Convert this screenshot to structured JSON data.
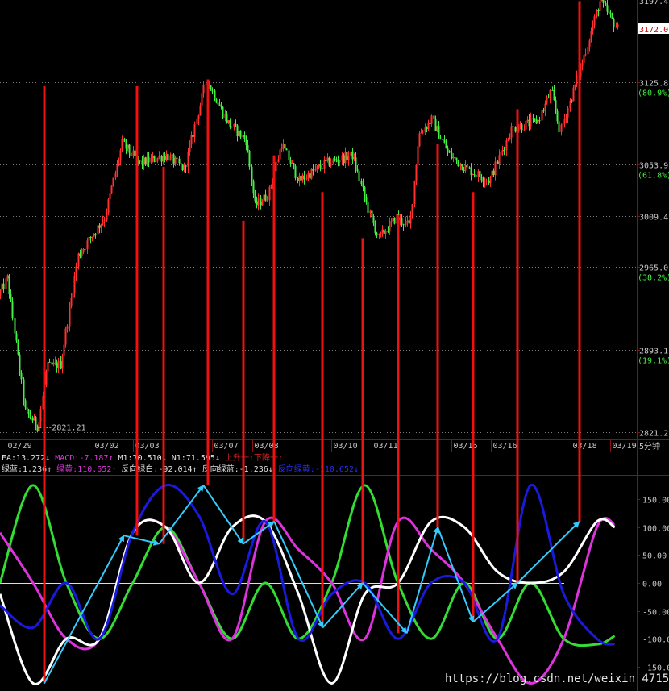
{
  "colors": {
    "background": "#000000",
    "panel_border": "#8a1010",
    "grid": "#7a7a7a",
    "candle_up": "#ff3030",
    "candle_down": "#44ee44",
    "axis_text": "#c8c8c8",
    "axis_pct": "#44ee44",
    "marker_line": "#ee1111",
    "green_wave": "#33dd33",
    "magenta_wave": "#dd33dd",
    "white_wave": "#ffffff",
    "blue_wave": "#1a1add",
    "arrow": "#33ccff",
    "price_tag_bg": "#ffffff",
    "price_tag_text": "#cc0000"
  },
  "chart_data": [
    {
      "type": "candlestick",
      "y_axis": {
        "ticks": [
          {
            "value": "3125.8",
            "pct": "(80.9%)"
          },
          {
            "value": "3053.9",
            "pct": "(61.8%)"
          },
          {
            "value": "3009.4",
            "pct": ""
          },
          {
            "value": "2965.0",
            "pct": "(38.2%)"
          },
          {
            "value": "2893.1",
            "pct": "(19.1%)"
          },
          {
            "value": "2821.2",
            "pct": ""
          }
        ],
        "top_partial_label": "3197.4",
        "ylim": [
          2815,
          3197
        ]
      },
      "current_price_label": "3172.0",
      "low_annotation": "2821.21",
      "x_tick_labels": [
        "02/29",
        "03/02",
        "03/03",
        "03/07",
        "03/08",
        "03/10",
        "03/11",
        "03/15",
        "03/16",
        "03/18",
        "03/19"
      ],
      "period_label": "5分钟",
      "price_path": [
        {
          "t": 0.0,
          "p": 2940
        },
        {
          "t": 1.0,
          "p": 2955
        },
        {
          "t": 3.0,
          "p": 2840
        },
        {
          "t": 4.5,
          "p": 2826
        },
        {
          "t": 5.5,
          "p": 2878
        },
        {
          "t": 7.0,
          "p": 2880
        },
        {
          "t": 9.0,
          "p": 2975
        },
        {
          "t": 12.0,
          "p": 3008
        },
        {
          "t": 14.0,
          "p": 3072
        },
        {
          "t": 16.0,
          "p": 3055
        },
        {
          "t": 19.0,
          "p": 3062
        },
        {
          "t": 21.0,
          "p": 3050
        },
        {
          "t": 23.5,
          "p": 3128
        },
        {
          "t": 26.0,
          "p": 3090
        },
        {
          "t": 28.0,
          "p": 3075
        },
        {
          "t": 29.0,
          "p": 3018
        },
        {
          "t": 30.5,
          "p": 3028
        },
        {
          "t": 32.0,
          "p": 3072
        },
        {
          "t": 34.0,
          "p": 3040
        },
        {
          "t": 37.0,
          "p": 3055
        },
        {
          "t": 40.0,
          "p": 3062
        },
        {
          "t": 42.0,
          "p": 3010
        },
        {
          "t": 43.0,
          "p": 2990
        },
        {
          "t": 45.0,
          "p": 3008
        },
        {
          "t": 46.5,
          "p": 3000
        },
        {
          "t": 47.5,
          "p": 3080
        },
        {
          "t": 49.0,
          "p": 3093
        },
        {
          "t": 51.0,
          "p": 3062
        },
        {
          "t": 53.0,
          "p": 3050
        },
        {
          "t": 55.5,
          "p": 3040
        },
        {
          "t": 58.0,
          "p": 3085
        },
        {
          "t": 61.0,
          "p": 3092
        },
        {
          "t": 62.5,
          "p": 3118
        },
        {
          "t": 63.5,
          "p": 3082
        },
        {
          "t": 65.5,
          "p": 3130
        },
        {
          "t": 68.0,
          "p": 3196
        },
        {
          "t": 70.0,
          "p": 3172
        }
      ]
    },
    {
      "type": "line",
      "header_line_1": [
        {
          "text": "EA:13.272↓",
          "color": "#e0e0e0"
        },
        {
          "text": "MACD:-7.187↑",
          "color": "#dd33dd"
        },
        {
          "text": "M1:70.510↓",
          "color": "#e0e0e0"
        },
        {
          "text": "N1:71.595↓",
          "color": "#e0e0e0"
        },
        {
          "text": "上升一:下降一:",
          "color": "#dd2222"
        }
      ],
      "header_line_2": [
        {
          "text": "绿蓝:1.236↑",
          "color": "#e0e0e0"
        },
        {
          "text": "绿黄:110.652↑",
          "color": "#dd33dd"
        },
        {
          "text": "反向绿白:-92.014↑",
          "color": "#e0e0e0"
        },
        {
          "text": "反向绿蓝:-1.236↓",
          "color": "#e0e0e0"
        },
        {
          "text": "反向绿黄:-110.652↓",
          "color": "#2a2aff"
        }
      ],
      "y_axis": {
        "ticks": [
          "150.00",
          "100.00",
          "50.00",
          "0.00",
          "-50.00",
          "-100.00",
          "-150.00"
        ],
        "ylim": [
          -185,
          185
        ]
      },
      "series": [
        {
          "color_key": "green_wave",
          "points": [
            [
              0,
              0
            ],
            [
              3.75,
              175
            ],
            [
              7.5,
              0
            ],
            [
              11.25,
              -100
            ],
            [
              15,
              0
            ],
            [
              18.75,
              100
            ],
            [
              22.5,
              0
            ],
            [
              26.25,
              -100
            ],
            [
              30,
              0
            ],
            [
              33.75,
              -100
            ],
            [
              37.5,
              0
            ],
            [
              41.25,
              175
            ],
            [
              45,
              0
            ],
            [
              48.75,
              -100
            ],
            [
              52.5,
              0
            ],
            [
              56.25,
              -100
            ],
            [
              60,
              0
            ],
            [
              63.75,
              -100
            ],
            [
              67.5,
              -110
            ],
            [
              69.5,
              -95
            ]
          ]
        },
        {
          "color_key": "magenta_wave",
          "points": [
            [
              0,
              90
            ],
            [
              3.75,
              0
            ],
            [
              7.5,
              -100
            ],
            [
              11.25,
              -100
            ],
            [
              15,
              90
            ],
            [
              18.75,
              100
            ],
            [
              22.5,
              0
            ],
            [
              26.25,
              -100
            ],
            [
              30,
              110
            ],
            [
              33.75,
              60
            ],
            [
              37.5,
              0
            ],
            [
              41.25,
              -100
            ],
            [
              45,
              110
            ],
            [
              48.75,
              60
            ],
            [
              52.5,
              0
            ],
            [
              56.25,
              -100
            ],
            [
              60,
              -180
            ],
            [
              63.75,
              -100
            ],
            [
              67.5,
              100
            ],
            [
              69.5,
              105
            ]
          ]
        },
        {
          "color_key": "white_wave",
          "points": [
            [
              0,
              -20
            ],
            [
              3.75,
              -180
            ],
            [
              7.5,
              -100
            ],
            [
              11.25,
              -100
            ],
            [
              15,
              90
            ],
            [
              18.75,
              100
            ],
            [
              22.5,
              0
            ],
            [
              26.25,
              100
            ],
            [
              30,
              110
            ],
            [
              33.75,
              -20
            ],
            [
              37.5,
              -180
            ],
            [
              41.25,
              -20
            ],
            [
              45,
              0
            ],
            [
              48.75,
              110
            ],
            [
              52.5,
              100
            ],
            [
              56.25,
              20
            ],
            [
              60,
              0
            ],
            [
              63.75,
              20
            ],
            [
              67.5,
              110
            ],
            [
              69.5,
              100
            ]
          ]
        },
        {
          "color_key": "blue_wave",
          "points": [
            [
              0,
              -40
            ],
            [
              3.75,
              -80
            ],
            [
              7.5,
              0
            ],
            [
              11.25,
              -100
            ],
            [
              15,
              90
            ],
            [
              18.75,
              175
            ],
            [
              22.5,
              120
            ],
            [
              26.25,
              -20
            ],
            [
              30,
              110
            ],
            [
              33.75,
              -100
            ],
            [
              37.5,
              -20
            ],
            [
              41.25,
              0
            ],
            [
              45,
              -100
            ],
            [
              48.75,
              0
            ],
            [
              52.5,
              0
            ],
            [
              56.25,
              -100
            ],
            [
              60,
              175
            ],
            [
              63.75,
              -20
            ],
            [
              67.5,
              -100
            ],
            [
              69.5,
              -110
            ]
          ]
        }
      ],
      "arrows": [
        [
          5,
          -180,
          14,
          85
        ],
        [
          14,
          85,
          18,
          70
        ],
        [
          18,
          70,
          23,
          175
        ],
        [
          23,
          175,
          27.5,
          70
        ],
        [
          27.5,
          70,
          31,
          110
        ],
        [
          31,
          110,
          36.5,
          -80
        ],
        [
          36.5,
          -80,
          41,
          0
        ],
        [
          41,
          0,
          46,
          -90
        ],
        [
          46,
          -90,
          49.5,
          100
        ],
        [
          49.5,
          100,
          53.5,
          -70
        ],
        [
          53.5,
          -70,
          58.5,
          0
        ],
        [
          58.5,
          0,
          65.5,
          110
        ]
      ]
    }
  ],
  "markers": {
    "line_positions": [
      5,
      15.5,
      18.5,
      23.5,
      27.5,
      31,
      36.5,
      41,
      45,
      49.5,
      53.5,
      58.5,
      65.5
    ],
    "top_values": [
      3122,
      3122,
      3052,
      3128,
      3005,
      3062,
      3030,
      2990,
      3010,
      3072,
      3030,
      3102,
      3196
    ],
    "bottom_values": [
      -180,
      85,
      70,
      175,
      70,
      110,
      -80,
      0,
      -90,
      100,
      -70,
      0,
      110
    ]
  },
  "watermark": "https://blog.csdn.net/weixin_47150696"
}
